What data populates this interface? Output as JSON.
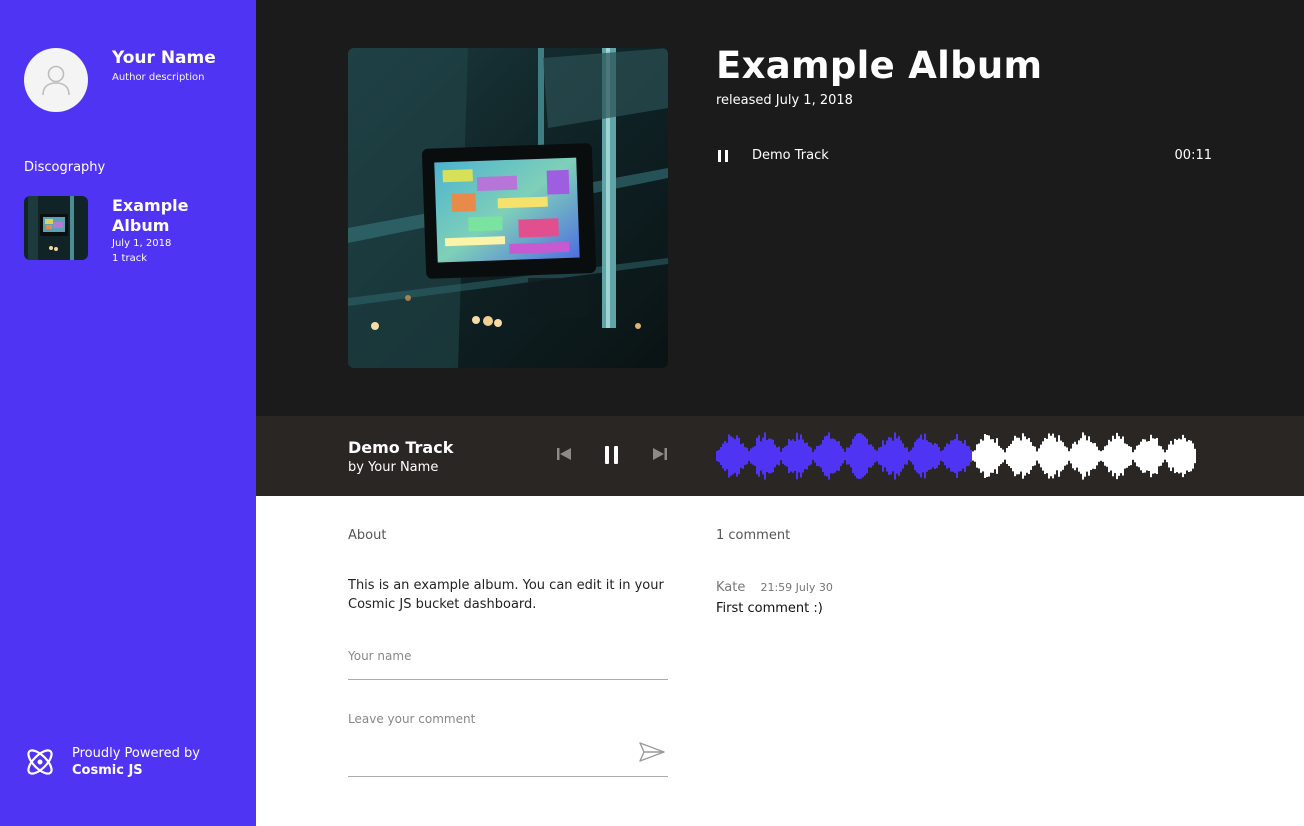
{
  "author": {
    "name": "Your Name",
    "description": "Author description",
    "avatar_icon": "user-silhouette-icon"
  },
  "sidebar": {
    "discography_heading": "Discography",
    "albums": [
      {
        "title": "Example Album",
        "date": "July 1, 2018",
        "tracks": "1 track"
      }
    ],
    "powered": {
      "line1": "Proudly Powered by",
      "line2": "Cosmic JS",
      "logo_icon": "cosmic-js-logo-icon"
    }
  },
  "album": {
    "title": "Example Album",
    "released": "released July 1, 2018",
    "tracks": [
      {
        "name": "Demo Track",
        "duration": "00:11",
        "state_icon": "pause-icon"
      }
    ]
  },
  "player": {
    "title": "Demo Track",
    "artist": "by Your Name",
    "progress": 0.53,
    "played_color": "#4f35f3",
    "unplayed_color": "#ffffff"
  },
  "about": {
    "heading": "About",
    "text": "This is an example album. You can edit it in your Cosmic JS bucket dashboard."
  },
  "form": {
    "name_placeholder": "Your name",
    "comment_placeholder": "Leave your comment"
  },
  "comments": {
    "heading": "1 comment",
    "items": [
      {
        "author": "Kate",
        "time": "21:59 July 30",
        "text": "First comment :)"
      }
    ]
  },
  "colors": {
    "sidebar": "#4f35f3",
    "hero": "#1b1b1b",
    "player": "#2a2624"
  }
}
